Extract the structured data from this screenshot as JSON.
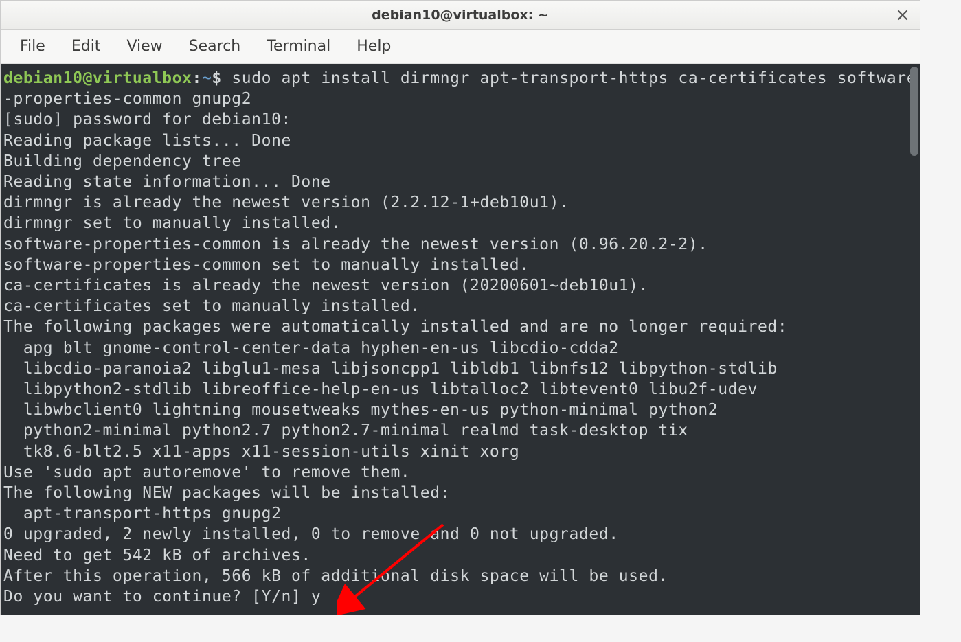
{
  "window": {
    "title": "debian10@virtualbox: ~"
  },
  "menu": {
    "file": "File",
    "edit": "Edit",
    "view": "View",
    "search": "Search",
    "terminal": "Terminal",
    "help": "Help"
  },
  "prompt": {
    "user_host": "debian10@virtualbox",
    "sep": ":",
    "path": "~",
    "symbol": "$"
  },
  "command": "sudo apt install dirmngr apt-transport-https ca-certificates software-properties-common gnupg2",
  "output": "[sudo] password for debian10: \nReading package lists... Done\nBuilding dependency tree       \nReading state information... Done\ndirmngr is already the newest version (2.2.12-1+deb10u1).\ndirmngr set to manually installed.\nsoftware-properties-common is already the newest version (0.96.20.2-2).\nsoftware-properties-common set to manually installed.\nca-certificates is already the newest version (20200601~deb10u1).\nca-certificates set to manually installed.\nThe following packages were automatically installed and are no longer required:\n  apg blt gnome-control-center-data hyphen-en-us libcdio-cdda2\n  libcdio-paranoia2 libglu1-mesa libjsoncpp1 libldb1 libnfs12 libpython-stdlib\n  libpython2-stdlib libreoffice-help-en-us libtalloc2 libtevent0 libu2f-udev\n  libwbclient0 lightning mousetweaks mythes-en-us python-minimal python2\n  python2-minimal python2.7 python2.7-minimal realmd task-desktop tix\n  tk8.6-blt2.5 x11-apps x11-session-utils xinit xorg\nUse 'sudo apt autoremove' to remove them.\nThe following NEW packages will be installed:\n  apt-transport-https gnupg2\n0 upgraded, 2 newly installed, 0 to remove and 0 not upgraded.\nNeed to get 542 kB of archives.\nAfter this operation, 566 kB of additional disk space will be used.\nDo you want to continue? [Y/n] y"
}
